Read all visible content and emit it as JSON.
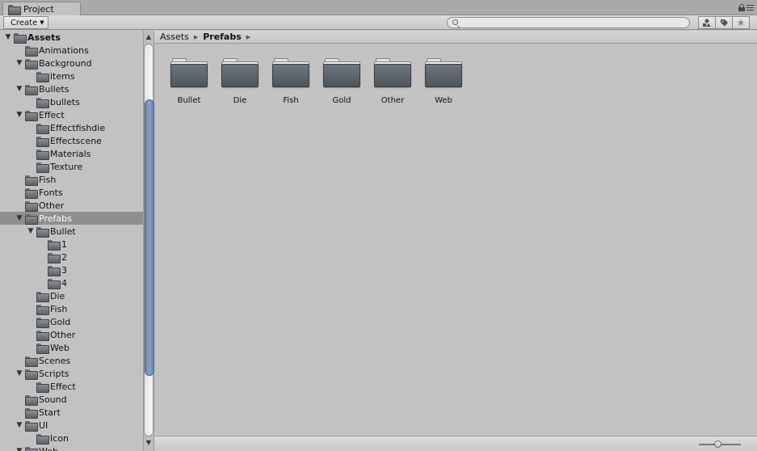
{
  "window": {
    "tab_label": "Project"
  },
  "toolbar": {
    "create_label": "Create",
    "search_placeholder": ""
  },
  "breadcrumb": {
    "root": "Assets",
    "current": "Prefabs"
  },
  "tree": [
    {
      "label": "Assets",
      "depth": 0,
      "expanded": true,
      "bold": true
    },
    {
      "label": "Animations",
      "depth": 1,
      "expanded": null
    },
    {
      "label": "Background",
      "depth": 1,
      "expanded": true
    },
    {
      "label": "items",
      "depth": 2,
      "expanded": null
    },
    {
      "label": "Bullets",
      "depth": 1,
      "expanded": true
    },
    {
      "label": "bullets",
      "depth": 2,
      "expanded": null
    },
    {
      "label": "Effect",
      "depth": 1,
      "expanded": true
    },
    {
      "label": "Effectfishdie",
      "depth": 2,
      "expanded": null
    },
    {
      "label": "Effectscene",
      "depth": 2,
      "expanded": null
    },
    {
      "label": "Materials",
      "depth": 2,
      "expanded": null
    },
    {
      "label": "Texture",
      "depth": 2,
      "expanded": null
    },
    {
      "label": "Fish",
      "depth": 1,
      "expanded": null
    },
    {
      "label": "Fonts",
      "depth": 1,
      "expanded": null
    },
    {
      "label": "Other",
      "depth": 1,
      "expanded": null
    },
    {
      "label": "Prefabs",
      "depth": 1,
      "expanded": true,
      "selected": true
    },
    {
      "label": "Bullet",
      "depth": 2,
      "expanded": true
    },
    {
      "label": "1",
      "depth": 3,
      "expanded": null
    },
    {
      "label": "2",
      "depth": 3,
      "expanded": null
    },
    {
      "label": "3",
      "depth": 3,
      "expanded": null
    },
    {
      "label": "4",
      "depth": 3,
      "expanded": null
    },
    {
      "label": "Die",
      "depth": 2,
      "expanded": null
    },
    {
      "label": "Fish",
      "depth": 2,
      "expanded": null
    },
    {
      "label": "Gold",
      "depth": 2,
      "expanded": null
    },
    {
      "label": "Other",
      "depth": 2,
      "expanded": null
    },
    {
      "label": "Web",
      "depth": 2,
      "expanded": null
    },
    {
      "label": "Scenes",
      "depth": 1,
      "expanded": null
    },
    {
      "label": "Scripts",
      "depth": 1,
      "expanded": true
    },
    {
      "label": "Effect",
      "depth": 2,
      "expanded": null
    },
    {
      "label": "Sound",
      "depth": 1,
      "expanded": null
    },
    {
      "label": "Start",
      "depth": 1,
      "expanded": null
    },
    {
      "label": "UI",
      "depth": 1,
      "expanded": true
    },
    {
      "label": "Icon",
      "depth": 2,
      "expanded": null
    },
    {
      "label": "Web",
      "depth": 1,
      "expanded": true
    }
  ],
  "grid_items": [
    {
      "label": "Bullet"
    },
    {
      "label": "Die"
    },
    {
      "label": "Fish"
    },
    {
      "label": "Gold"
    },
    {
      "label": "Other"
    },
    {
      "label": "Web"
    }
  ],
  "icons": {
    "tab": "folder-icon",
    "lock": "lock-icon",
    "menu": "menu-icon",
    "search": "search-icon",
    "filter_type": "filter-by-type-icon",
    "filter_label": "filter-by-label-icon",
    "favorite": "favorite-star-icon"
  },
  "colors": {
    "panel_bg": "#c2c2c2",
    "selected_row": "#8f8f8f",
    "scroll_thumb": "#7d96bb",
    "folder_body": "#5b6166"
  }
}
